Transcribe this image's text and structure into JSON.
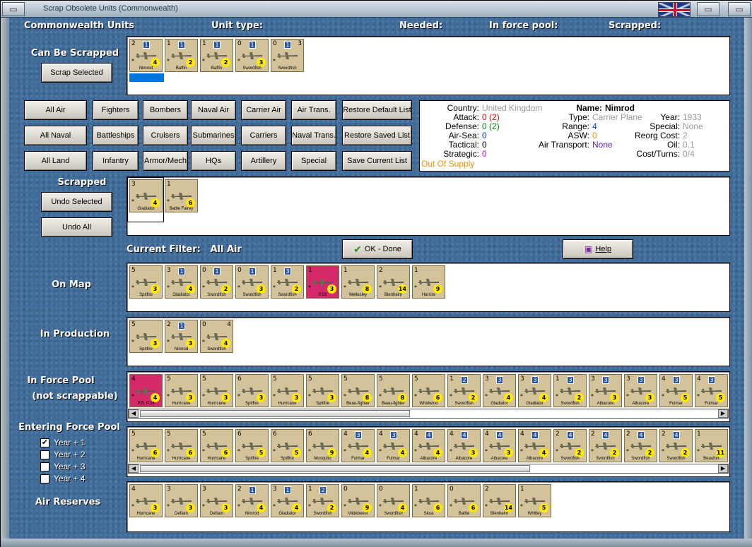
{
  "window": {
    "title": "Scrap Obsolete Units (Commonwealth)"
  },
  "header": {
    "col1": "Commonwealth Units",
    "col2": "Unit type:",
    "col3": "Needed:",
    "col4": "In force pool:",
    "col5": "Scrapped:"
  },
  "sections": {
    "can_be_scrapped": "Can Be Scrapped",
    "scrapped": "Scrapped",
    "current_filter": "Current Filter:",
    "filter_value": "All Air",
    "on_map": "On Map",
    "in_production": "In Production",
    "in_force_pool_1": "In Force Pool",
    "in_force_pool_2": "(not scrappable)",
    "entering": "Entering Force Pool",
    "reserves": "Air Reserves"
  },
  "buttons": {
    "scrap_selected": "Scrap Selected",
    "undo_selected": "Undo Selected",
    "undo_all": "Undo All",
    "ok_done": "OK - Done",
    "help": "Help"
  },
  "filters": [
    [
      "All Air",
      "Fighters",
      "Bombers",
      "Naval Air",
      "Carrier Air",
      "Air Trans.",
      "Restore Default List"
    ],
    [
      "All Naval",
      "Battleships",
      "Cruisers",
      "Submarines",
      "Carriers",
      "Naval Trans.",
      "Restore Saved List"
    ],
    [
      "All Land",
      "Infantry",
      "Armor/Mech",
      "HQs",
      "Artillery",
      "Special",
      "Save Current List"
    ]
  ],
  "info": {
    "country_k": "Country:",
    "country_v": "United Kingdom",
    "attack_k": "Attack:",
    "attack_v": "0",
    "attack_v2": "(2)",
    "defense_k": "Defense:",
    "defense_v": "0",
    "defense_v2": "(2)",
    "airsea_k": "Air-Sea:",
    "airsea_v": "0",
    "tactical_k": "Tactical:",
    "tactical_v": "0",
    "strategic_k": "Strategic:",
    "strategic_v": "0",
    "supply": "Out Of Supply",
    "name_k": "Name:",
    "name_v": "Nimrod",
    "type_k": "Type:",
    "type_v": "Carrier Plane",
    "range_k": "Range:",
    "range_v": "4",
    "asw_k": "ASW:",
    "asw_v": "0",
    "airtrans_k": "Air Transport:",
    "airtrans_v": "None",
    "year_k": "Year:",
    "year_v": "1933",
    "special_k": "Special:",
    "special_v": "None",
    "reorg_k": "Reorg Cost:",
    "reorg_v": "2",
    "oil_k": "Oil:",
    "oil_v": "0.1",
    "cost_k": "Cost/Turns:",
    "cost_v": "0/4"
  },
  "checks": [
    {
      "label": "Year + 1",
      "checked": true
    },
    {
      "label": "Year + 2",
      "checked": false
    },
    {
      "label": "Year + 3",
      "checked": false
    },
    {
      "label": "Year + 4",
      "checked": false
    }
  ],
  "units": {
    "can_be_scrapped": [
      {
        "n": "Nimrod",
        "tl": "2",
        "tr": "",
        "num": "1",
        "d": "4"
      },
      {
        "n": "Baffin",
        "tl": "1",
        "tr": "",
        "num": "1",
        "d": "2"
      },
      {
        "n": "Baffin",
        "tl": "1",
        "tr": "",
        "num": "1",
        "d": "2"
      },
      {
        "n": "Swordfish",
        "tl": "0",
        "tr": "",
        "num": "1",
        "d": "3"
      },
      {
        "n": "Swordfish",
        "tl": "0",
        "tr": "3",
        "num": "1",
        "d": ""
      }
    ],
    "scrapped": [
      {
        "n": "Gladiator",
        "tl": "3",
        "tr": "",
        "num": "",
        "d": "4"
      },
      {
        "n": "Battle Fairey",
        "tl": "1",
        "tr": "",
        "num": "",
        "d": "6"
      }
    ],
    "on_map": [
      {
        "n": "Spitfire",
        "tl": "5",
        "d": "3"
      },
      {
        "n": "Gladiator",
        "tl": "3",
        "num": "1",
        "d": "4"
      },
      {
        "n": "Swordfish",
        "tl": "0",
        "num": "1",
        "d": "2"
      },
      {
        "n": "Swordfish",
        "tl": "0",
        "num": "1",
        "d": "3"
      },
      {
        "n": "Swordfish",
        "tl": "1",
        "num": "3",
        "d": "2"
      },
      {
        "n": "P.23",
        "tl": "1",
        "d": "3",
        "pink": true
      },
      {
        "n": "Wellesley",
        "tl": "1",
        "d": "8"
      },
      {
        "n": "Blenheim",
        "tl": "2",
        "d": "14"
      },
      {
        "n": "Harrow",
        "tl": "1",
        "d": "9"
      }
    ],
    "in_production": [
      {
        "n": "Spitfire",
        "tl": "5",
        "d": "3"
      },
      {
        "n": "Nimrod",
        "tl": "2",
        "num": "1",
        "d": "3"
      },
      {
        "n": "Swordfish",
        "tl": "0",
        "tr": "4",
        "d": "4"
      }
    ],
    "in_force_pool": [
      {
        "n": "PZL P.24",
        "tl": "4",
        "d": "4",
        "pink": true
      },
      {
        "n": "Hurricane",
        "tl": "5",
        "d": "3"
      },
      {
        "n": "Hurricane",
        "tl": "5",
        "d": "3"
      },
      {
        "n": "Spitfire",
        "tl": "6",
        "d": "3"
      },
      {
        "n": "Hurricane",
        "tl": "5",
        "d": "3"
      },
      {
        "n": "Spitfire",
        "tl": "5",
        "d": "3"
      },
      {
        "n": "Beau-fighter",
        "tl": "5",
        "d": "8"
      },
      {
        "n": "Beau-fighter",
        "tl": "5",
        "d": "8"
      },
      {
        "n": "Whirlwind",
        "tl": "5",
        "d": "6"
      },
      {
        "n": "Swordfish",
        "tl": "1",
        "num": "2",
        "d": "2"
      },
      {
        "n": "Gladiator",
        "tl": "3",
        "num": "3",
        "d": "4"
      },
      {
        "n": "Gladiator",
        "tl": "3",
        "num": "3",
        "d": "4"
      },
      {
        "n": "Swordfish",
        "tl": "1",
        "num": "3",
        "d": "2"
      },
      {
        "n": "Albacore",
        "tl": "3",
        "num": "3",
        "d": "3"
      },
      {
        "n": "Albacore",
        "tl": "3",
        "num": "3",
        "d": "3"
      },
      {
        "n": "Fulmar",
        "tl": "4",
        "num": "3",
        "d": "5"
      },
      {
        "n": "Fulmar",
        "tl": "4",
        "num": "3",
        "d": "5"
      }
    ],
    "entering": [
      {
        "n": "Hurricane",
        "tl": "5",
        "d": "6"
      },
      {
        "n": "Hurricane",
        "tl": "5",
        "d": "6"
      },
      {
        "n": "Hurricane",
        "tl": "5",
        "d": "6"
      },
      {
        "n": "Spitfire",
        "tl": "6",
        "d": "5"
      },
      {
        "n": "Spitfire",
        "tl": "6",
        "d": "5"
      },
      {
        "n": "Mosquito",
        "tl": "6",
        "d": "9"
      },
      {
        "n": "Fulmar",
        "tl": "4",
        "num": "3",
        "d": "4"
      },
      {
        "n": "Fulmar",
        "tl": "4",
        "num": "3",
        "d": "4"
      },
      {
        "n": "Albacore",
        "tl": "4",
        "num": "4",
        "d": "4"
      },
      {
        "n": "Albacore",
        "tl": "4",
        "num": "4",
        "d": "3"
      },
      {
        "n": "Albacore",
        "tl": "4",
        "num": "4",
        "d": "3"
      },
      {
        "n": "Albacore",
        "tl": "4",
        "num": "4",
        "d": "4"
      },
      {
        "n": "Swordfish",
        "tl": "2",
        "num": "4",
        "d": "2"
      },
      {
        "n": "Swordfish",
        "tl": "2",
        "num": "4",
        "d": "2"
      },
      {
        "n": "Swordfish",
        "tl": "2",
        "num": "4",
        "d": "2"
      },
      {
        "n": "Swordfish",
        "tl": "2",
        "num": "4",
        "d": "2"
      },
      {
        "n": "Beaufort",
        "tl": "1",
        "d": "11"
      }
    ],
    "reserves": [
      {
        "n": "Hurricane",
        "tl": "4",
        "d": "3"
      },
      {
        "n": "Defiant",
        "tl": "3",
        "d": "3"
      },
      {
        "n": "Defiant",
        "tl": "3",
        "d": "3"
      },
      {
        "n": "Nimrod",
        "tl": "2",
        "num": "1",
        "d": "4"
      },
      {
        "n": "Gladiator",
        "tl": "3",
        "num": "1",
        "d": "4"
      },
      {
        "n": "Swordfish",
        "tl": "1",
        "num": "2",
        "d": "2"
      },
      {
        "n": "Vildebeest",
        "tl": "0",
        "d": "9"
      },
      {
        "n": "Swordfish",
        "tl": "0",
        "d": "4"
      },
      {
        "n": "Skua",
        "tl": "1",
        "d": "6"
      },
      {
        "n": "Battle",
        "tl": "0",
        "d": "6"
      },
      {
        "n": "Blenheim",
        "tl": "2",
        "d": "14"
      },
      {
        "n": "Whitley",
        "tl": "1",
        "d": "5"
      }
    ]
  },
  "colors": {
    "background": "#3f6c9a",
    "selection": "#0073dd",
    "counter": "#d4c39a",
    "pink": "#d42a6a",
    "badge": "#ffea00"
  }
}
